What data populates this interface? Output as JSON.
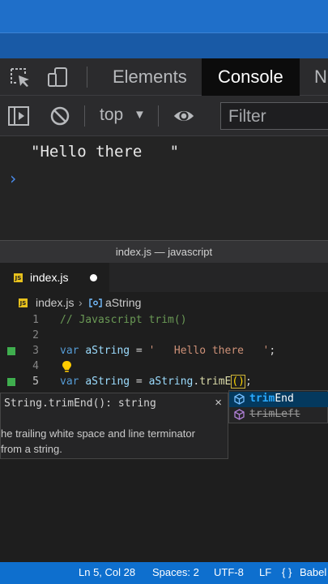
{
  "devtools": {
    "tabs": [
      "Elements",
      "Console",
      "N"
    ],
    "active_tab": "Console",
    "context_selector": "top",
    "filter_placeholder": "Filter",
    "console_output": "\"Hello there   \"",
    "prompt_symbol": "›"
  },
  "editor": {
    "window_title": "index.js — javascript",
    "tab_label": "index.js",
    "file_icon_label": "JS",
    "breadcrumb": {
      "file": "index.js",
      "symbol": "aString"
    },
    "lines": [
      {
        "num": "1",
        "comment": "// Javascript trim()"
      },
      {
        "num": "2"
      },
      {
        "num": "3",
        "kw": "var",
        "name": "aString",
        "op": " = ",
        "string": "'   Hello there   '",
        "end": ";"
      },
      {
        "num": "4"
      },
      {
        "num": "5",
        "kw": "var",
        "name": "aString",
        "op": " = ",
        "obj": "aString",
        "dot": ".",
        "method": "trimE",
        "parens": "()",
        "end": ";"
      }
    ],
    "doc": {
      "signature": "String.trimEnd(): string",
      "close_symbol": "×",
      "description_1": "he trailing white space and line terminator",
      "description_2": " from a string."
    },
    "suggestions": [
      {
        "match": "trim",
        "rest": "End",
        "selected": true
      },
      {
        "match": "trim",
        "rest": "Left",
        "selected": false,
        "deprecated": true
      }
    ]
  },
  "status_bar": {
    "position": "Ln 5, Col 28",
    "spaces": "Spaces: 2",
    "encoding": "UTF-8",
    "eol": "LF",
    "language_icon": "{ }",
    "language": "Babel"
  },
  "colors": {
    "status_bar": "#0e6fce",
    "devtools_bg": "#2b2b2d",
    "editor_bg": "#1e1e1e",
    "git_added": "#3fae4e"
  }
}
